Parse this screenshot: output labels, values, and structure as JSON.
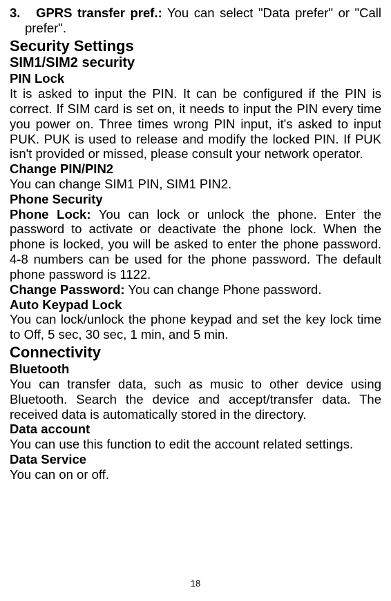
{
  "item3": {
    "num": "3.",
    "label": "GPRS transfer pref.:",
    "text": " You can select \"Data prefer\" or \"Call prefer\"."
  },
  "sec1": {
    "h1": "Security Settings",
    "h2": "SIM1/SIM2 security",
    "pinlock_h": "PIN Lock",
    "pinlock_p": "It is asked to input the PIN. It can be configured if the PIN is correct. If SIM card is set on, it needs to input the PIN every time you power on. Three times wrong PIN input, it's asked to input PUK. PUK is used to release and modify the locked PIN. If PUK isn't provided or missed, please consult your network operator.",
    "changepin_h": "Change PIN/PIN2",
    "changepin_p": "You can change SIM1 PIN, SIM1 PIN2.",
    "phonesec_h": "Phone Security",
    "phonelock_b": "Phone Lock:",
    "phonelock_p": " You can lock or unlock the phone. Enter the password to activate or deactivate the phone lock. When the phone is locked, you will be asked to enter the phone password. 4-8 numbers can be used for the phone password. The default phone password is 1122.",
    "changepw_b": "Change Password:",
    "changepw_p": " You can change Phone password.",
    "autokey_h": "Auto Keypad Lock",
    "autokey_p": "You can lock/unlock the phone keypad and set the key lock time to Off, 5 sec, 30 sec, 1 min, and 5 min."
  },
  "sec2": {
    "h1": "Connectivity",
    "bt_h": "Bluetooth",
    "bt_p": "You can transfer data, such as music to other device using Bluetooth. Search the device and accept/transfer data. The received data is automatically stored in the directory.",
    "da_h": "Data account",
    "da_p": "You can use this function to edit the account related settings.",
    "ds_h": "Data Service",
    "ds_p": "You can on or off."
  },
  "page_number": "18"
}
